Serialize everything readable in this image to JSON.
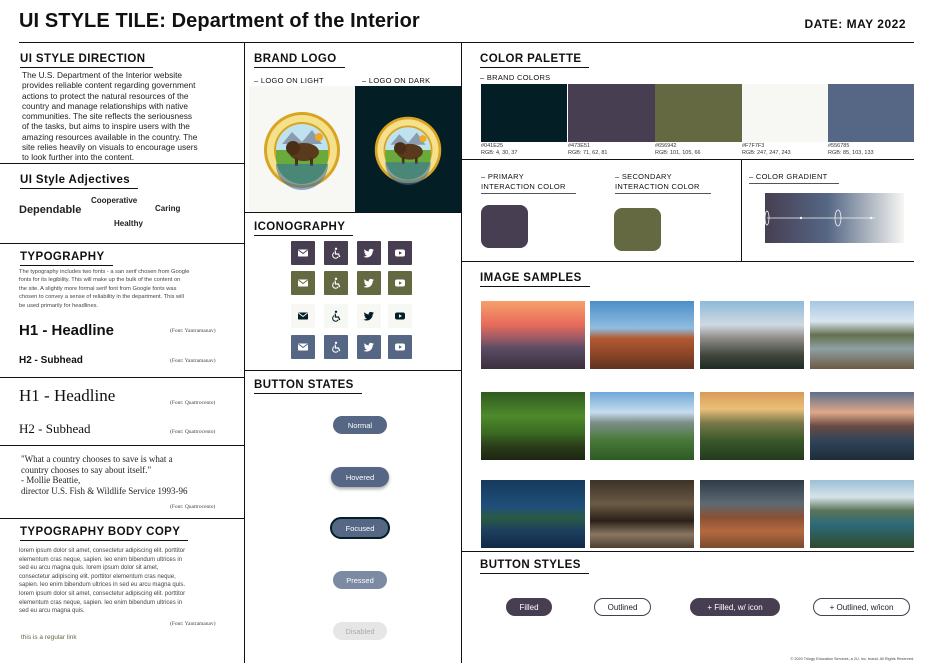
{
  "header": {
    "title": "UI STYLE TILE: Department of the Interior",
    "date": "DATE: MAY 2022"
  },
  "direction": {
    "heading": "UI STYLE DIRECTION",
    "lines": [
      "The U.S. Department of the Interior website",
      "provides reliable content regarding government",
      "actions to protect the natural resources of the",
      "country and manage relationships with native",
      "communities. The site reflects the seriousness",
      "of the tasks, but aims to inspire users with the",
      "amazing resources available in the country. The",
      "site relies heavily on visuals to encourage users",
      "to look further into the content."
    ]
  },
  "adjectives": {
    "heading": "UI Style Adjectives",
    "words": [
      "Dependable",
      "Cooperative",
      "Caring",
      "Healthy"
    ]
  },
  "typography": {
    "heading": "TYPOGRAPHY",
    "lines": [
      "The typography includes two fonts - a san serif chosen from Google",
      "fonts for its legibility. This will make up the bulk of the content on",
      "the site. A slightly more formal serif font from Google fonts was",
      "chosen to convey a sense of reliability in the department. This will",
      "be used primarily for headlines."
    ],
    "h1_sans": "H1 - Headline",
    "h1_sans_font": "(Font: Yantramanav)",
    "h2_sans": "H2 - Subhead",
    "h2_sans_font": "(Font: Yantramanav)",
    "h1_serif": "H1 - Headline",
    "h1_serif_font": "(Font: Quattrocento)",
    "h2_serif": "H2 - Subhead",
    "h2_serif_font": "(Font: Quattrocento)",
    "quote_lines": [
      "\"What a country chooses to save is what a",
      "country chooses to say about itself.\"",
      " - Mollie Beattie,",
      "director U.S. Fish & Wildlife Service 1993-96"
    ],
    "quote_font": "(Font: Quattrocento)"
  },
  "body_copy": {
    "heading": "TYPOGRAPHY BODY COPY",
    "lines": [
      "lorem ipsum dolor sit amet, consectetur adipiscing elit. porttitor",
      "elementum cras neque, sapien. leo enim bibendum ultrices in",
      "sed eu arcu magna quis. lorem ipsum dolor sit amet,",
      "consectetur adipiscing elit. porttitor elementum cras neque,",
      "sapien. leo enim bibendum ultrices in sed eu arcu magna quis.",
      "lorem ipsum dolor sit amet, consectetur adipiscing elit. porttitor",
      "elementum cras neque, sapien. leo enim bibendum ultrices in",
      "sed eu arcu magna quis."
    ],
    "font_note": "(Font: Yantramanav)",
    "link": "this is a regular link"
  },
  "brand_logo": {
    "heading": "BRAND LOGO",
    "light_label": "– LOGO ON LIGHT",
    "dark_label": "– LOGO ON DARK",
    "logo_top_text": "U.S. DEPARTMENT OF THE INTERIOR",
    "logo_bottom_text": "MARCH 3, 1849"
  },
  "iconography": {
    "heading": "ICONOGRAPHY",
    "icons": [
      "email-icon",
      "accessibility-icon",
      "twitter-icon",
      "youtube-icon"
    ],
    "row_styles": [
      {
        "bg": "#473E51",
        "fg": "#ffffff"
      },
      {
        "bg": "#656942",
        "fg": "#ffffff"
      },
      {
        "bg": "#F7F7F3",
        "fg": "#041E25"
      },
      {
        "bg": "#556785",
        "fg": "#ffffff"
      }
    ]
  },
  "button_states": {
    "heading": "BUTTON STATES",
    "buttons": [
      "Normal",
      "Hovered",
      "Focused",
      "Pressed",
      "Disabled"
    ]
  },
  "palette": {
    "heading": "COLOR PALETTE",
    "brand_label": "– BRAND COLORS",
    "swatches": [
      {
        "hex": "#041E25",
        "rgb": "RGB: 4, 30, 37"
      },
      {
        "hex": "#473E51",
        "rgb": "RGB: 71, 62, 81"
      },
      {
        "hex": "#656942",
        "rgb": "RGB: 101, 105, 66"
      },
      {
        "hex": "#F7F7F3",
        "rgb": "RGB: 247, 247, 243"
      },
      {
        "hex": "#556785",
        "rgb": "RGB: 85, 103, 133"
      }
    ],
    "primary_label_1": "– PRIMARY",
    "primary_label_2": "INTERACTION COLOR",
    "primary_color": "#473E51",
    "secondary_label_1": "– SECONDARY",
    "secondary_label_2": "INTERACTION COLOR",
    "secondary_color": "#656942",
    "gradient_label": "– COLOR GRADIENT"
  },
  "images": {
    "heading": "IMAGE SAMPLES",
    "items": [
      "mountain-sunset",
      "arch-rock",
      "half-dome",
      "rocky-lake",
      "moose",
      "glacier-valley",
      "forest-sunset",
      "lake-mountains",
      "alligator",
      "bison",
      "sand-dunes",
      "river-canyon"
    ]
  },
  "button_styles": {
    "heading": "BUTTON STYLES",
    "filled": "Filled",
    "outlined": "Outlined",
    "filled_icon": "+ Filled, w/ icon",
    "outlined_icon": "+ Outlined, w/icon"
  },
  "footer": {
    "copyright": "© 2020 Trilogy Education Services, a 2U, Inc. brand. All Rights Reserved."
  }
}
